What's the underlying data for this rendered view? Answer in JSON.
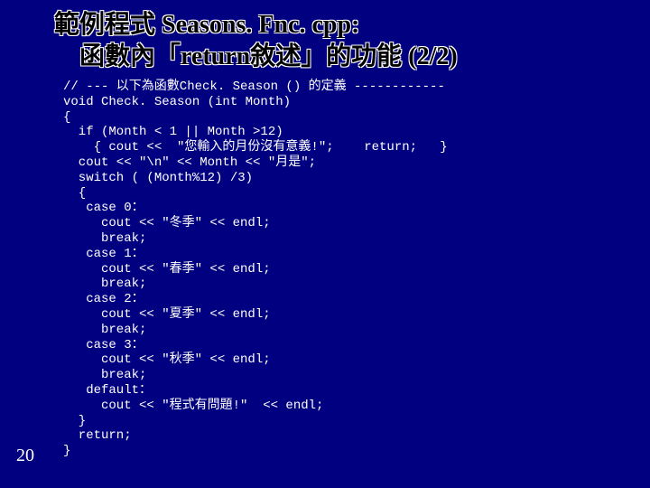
{
  "title": {
    "line1": "範例程式  Seasons. Fnc. cpp:",
    "line2": "函數內「return敘述」的功能  (2/2)"
  },
  "code": {
    "l01": "// --- 以下為函數Check. Season () 的定義 ------------",
    "l02": "void Check. Season (int Month)",
    "l03": "{",
    "l04": "  if (Month < 1 || Month >12)",
    "l05": "    { cout <<  \"您輸入的月份沒有意義!\";    return;   }",
    "l06": "  cout << \"\\n\" << Month << \"月是\";",
    "l07": "  switch ( (Month%12) /3)",
    "l08": "  {",
    "l09": "   case 0：",
    "l10": "     cout << \"冬季\" << endl;",
    "l11": "     break;",
    "l12": "   case 1：",
    "l13": "     cout << \"春季\" << endl;",
    "l14": "     break;",
    "l15": "   case 2：",
    "l16": "     cout << \"夏季\" << endl;",
    "l17": "     break;",
    "l18": "   case 3：",
    "l19": "     cout << \"秋季\" << endl;",
    "l20": "     break;",
    "l21": "   default：",
    "l22": "     cout << \"程式有問題!\"  << endl;",
    "l23": "  }",
    "l24": "  return;",
    "l25": "}"
  },
  "page_number": "20"
}
